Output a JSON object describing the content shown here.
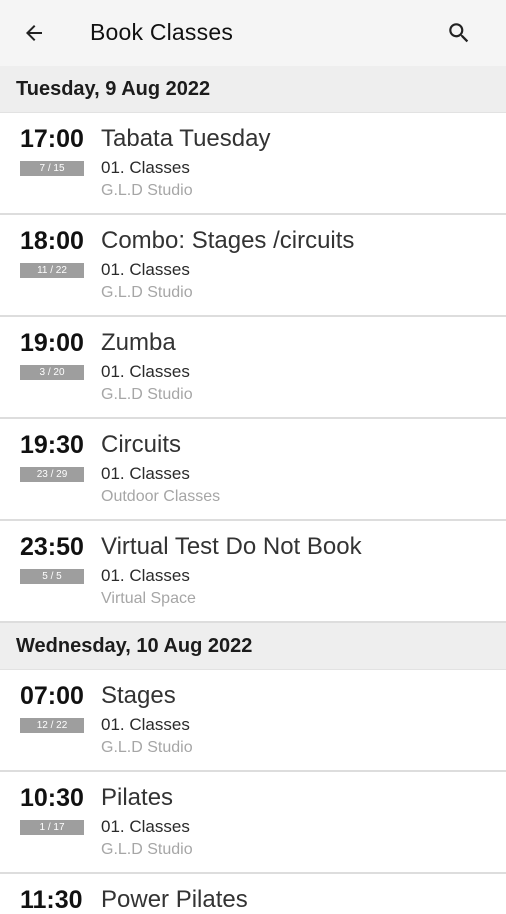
{
  "app_bar": {
    "title": "Book Classes",
    "back_icon": "arrow-left-icon",
    "search_icon": "search-icon"
  },
  "groups": [
    {
      "date": "Tuesday, 9 Aug 2022",
      "classes": [
        {
          "time": "17:00",
          "spots": "7 / 15",
          "name": "Tabata Tuesday",
          "category": "01. Classes",
          "location": "G.L.D Studio"
        },
        {
          "time": "18:00",
          "spots": "11 / 22",
          "name": "Combo: Stages /circuits",
          "category": "01. Classes",
          "location": "G.L.D Studio"
        },
        {
          "time": "19:00",
          "spots": "3 / 20",
          "name": "Zumba",
          "category": "01. Classes",
          "location": "G.L.D Studio"
        },
        {
          "time": "19:30",
          "spots": "23 / 29",
          "name": "Circuits",
          "category": "01. Classes",
          "location": "Outdoor Classes"
        },
        {
          "time": "23:50",
          "spots": "5 / 5",
          "name": "Virtual Test Do Not Book",
          "category": "01. Classes",
          "location": "Virtual Space"
        }
      ]
    },
    {
      "date": "Wednesday, 10 Aug 2022",
      "classes": [
        {
          "time": "07:00",
          "spots": "12 / 22",
          "name": "Stages",
          "category": "01. Classes",
          "location": "G.L.D Studio"
        },
        {
          "time": "10:30",
          "spots": "1 / 17",
          "name": "Pilates",
          "category": "01. Classes",
          "location": "G.L.D Studio"
        },
        {
          "time": "11:30",
          "spots": "",
          "name": "Power Pilates",
          "category": "",
          "location": ""
        }
      ]
    }
  ],
  "colors": {
    "app_bar_bg": "#f5f5f5",
    "date_header_bg": "#eeeeee",
    "badge_bg": "#9e9e9e",
    "location_text": "#a6a6a6"
  }
}
